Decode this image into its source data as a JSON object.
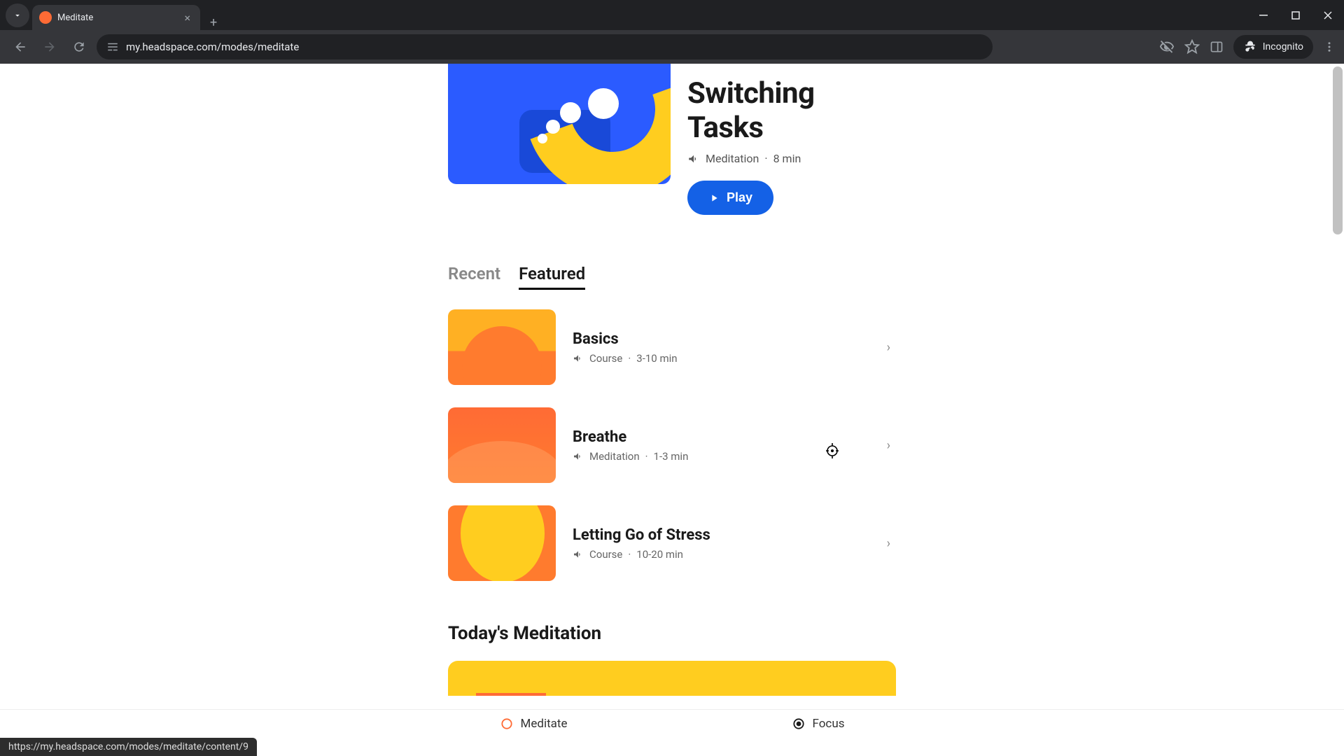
{
  "browser": {
    "tab_title": "Meditate",
    "url": "my.headspace.com/modes/meditate",
    "incognito_label": "Incognito",
    "status_url": "https://my.headspace.com/modes/meditate/content/9"
  },
  "hero": {
    "title": "Switching Tasks",
    "meta_type": "Meditation",
    "meta_duration": "8 min",
    "play_label": "Play"
  },
  "tabs": {
    "recent": "Recent",
    "featured": "Featured"
  },
  "items": [
    {
      "title": "Basics",
      "meta_type": "Course",
      "meta_duration": "3-10 min"
    },
    {
      "title": "Breathe",
      "meta_type": "Meditation",
      "meta_duration": "1-3 min"
    },
    {
      "title": "Letting Go of Stress",
      "meta_type": "Course",
      "meta_duration": "10-20 min"
    }
  ],
  "section_today": "Today's Meditation",
  "bottom_nav": {
    "meditate": "Meditate",
    "focus": "Focus"
  }
}
